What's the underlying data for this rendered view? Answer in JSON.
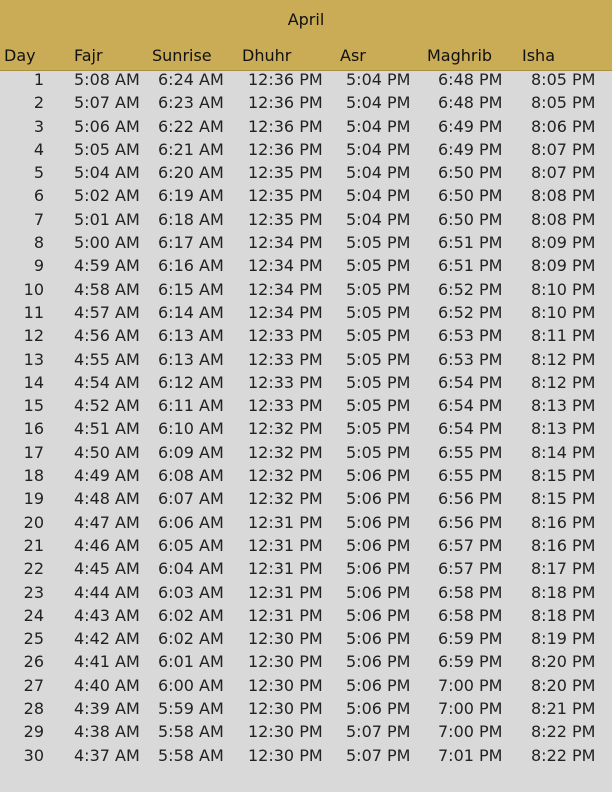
{
  "title": "April",
  "headers": {
    "day": "Day",
    "fajr": "Fajr",
    "sunrise": "Sunrise",
    "dhuhr": "Dhuhr",
    "asr": "Asr",
    "maghrib": "Maghrib",
    "isha": "Isha"
  },
  "rows": [
    [
      "1",
      "5:08 AM",
      "6:24 AM",
      "12:36 PM",
      "5:04 PM",
      "6:48 PM",
      "8:05 PM"
    ],
    [
      "2",
      "5:07 AM",
      "6:23 AM",
      "12:36 PM",
      "5:04 PM",
      "6:48 PM",
      "8:05 PM"
    ],
    [
      "3",
      "5:06 AM",
      "6:22 AM",
      "12:36 PM",
      "5:04 PM",
      "6:49 PM",
      "8:06 PM"
    ],
    [
      "4",
      "5:05 AM",
      "6:21 AM",
      "12:36 PM",
      "5:04 PM",
      "6:49 PM",
      "8:07 PM"
    ],
    [
      "5",
      "5:04 AM",
      "6:20 AM",
      "12:35 PM",
      "5:04 PM",
      "6:50 PM",
      "8:07 PM"
    ],
    [
      "6",
      "5:02 AM",
      "6:19 AM",
      "12:35 PM",
      "5:04 PM",
      "6:50 PM",
      "8:08 PM"
    ],
    [
      "7",
      "5:01 AM",
      "6:18 AM",
      "12:35 PM",
      "5:04 PM",
      "6:50 PM",
      "8:08 PM"
    ],
    [
      "8",
      "5:00 AM",
      "6:17 AM",
      "12:34 PM",
      "5:05 PM",
      "6:51 PM",
      "8:09 PM"
    ],
    [
      "9",
      "4:59 AM",
      "6:16 AM",
      "12:34 PM",
      "5:05 PM",
      "6:51 PM",
      "8:09 PM"
    ],
    [
      "10",
      "4:58 AM",
      "6:15 AM",
      "12:34 PM",
      "5:05 PM",
      "6:52 PM",
      "8:10 PM"
    ],
    [
      "11",
      "4:57 AM",
      "6:14 AM",
      "12:34 PM",
      "5:05 PM",
      "6:52 PM",
      "8:10 PM"
    ],
    [
      "12",
      "4:56 AM",
      "6:13 AM",
      "12:33 PM",
      "5:05 PM",
      "6:53 PM",
      "8:11 PM"
    ],
    [
      "13",
      "4:55 AM",
      "6:13 AM",
      "12:33 PM",
      "5:05 PM",
      "6:53 PM",
      "8:12 PM"
    ],
    [
      "14",
      "4:54 AM",
      "6:12 AM",
      "12:33 PM",
      "5:05 PM",
      "6:54 PM",
      "8:12 PM"
    ],
    [
      "15",
      "4:52 AM",
      "6:11 AM",
      "12:33 PM",
      "5:05 PM",
      "6:54 PM",
      "8:13 PM"
    ],
    [
      "16",
      "4:51 AM",
      "6:10 AM",
      "12:32 PM",
      "5:05 PM",
      "6:54 PM",
      "8:13 PM"
    ],
    [
      "17",
      "4:50 AM",
      "6:09 AM",
      "12:32 PM",
      "5:05 PM",
      "6:55 PM",
      "8:14 PM"
    ],
    [
      "18",
      "4:49 AM",
      "6:08 AM",
      "12:32 PM",
      "5:06 PM",
      "6:55 PM",
      "8:15 PM"
    ],
    [
      "19",
      "4:48 AM",
      "6:07 AM",
      "12:32 PM",
      "5:06 PM",
      "6:56 PM",
      "8:15 PM"
    ],
    [
      "20",
      "4:47 AM",
      "6:06 AM",
      "12:31 PM",
      "5:06 PM",
      "6:56 PM",
      "8:16 PM"
    ],
    [
      "21",
      "4:46 AM",
      "6:05 AM",
      "12:31 PM",
      "5:06 PM",
      "6:57 PM",
      "8:16 PM"
    ],
    [
      "22",
      "4:45 AM",
      "6:04 AM",
      "12:31 PM",
      "5:06 PM",
      "6:57 PM",
      "8:17 PM"
    ],
    [
      "23",
      "4:44 AM",
      "6:03 AM",
      "12:31 PM",
      "5:06 PM",
      "6:58 PM",
      "8:18 PM"
    ],
    [
      "24",
      "4:43 AM",
      "6:02 AM",
      "12:31 PM",
      "5:06 PM",
      "6:58 PM",
      "8:18 PM"
    ],
    [
      "25",
      "4:42 AM",
      "6:02 AM",
      "12:30 PM",
      "5:06 PM",
      "6:59 PM",
      "8:19 PM"
    ],
    [
      "26",
      "4:41 AM",
      "6:01 AM",
      "12:30 PM",
      "5:06 PM",
      "6:59 PM",
      "8:20 PM"
    ],
    [
      "27",
      "4:40 AM",
      "6:00 AM",
      "12:30 PM",
      "5:06 PM",
      "7:00 PM",
      "8:20 PM"
    ],
    [
      "28",
      "4:39 AM",
      "5:59 AM",
      "12:30 PM",
      "5:06 PM",
      "7:00 PM",
      "8:21 PM"
    ],
    [
      "29",
      "4:38 AM",
      "5:58 AM",
      "12:30 PM",
      "5:07 PM",
      "7:00 PM",
      "8:22 PM"
    ],
    [
      "30",
      "4:37 AM",
      "5:58 AM",
      "12:30 PM",
      "5:07 PM",
      "7:01 PM",
      "8:22 PM"
    ]
  ],
  "colors": {
    "header_band": "#c9ac55",
    "page_background": "#d9d9d9"
  }
}
